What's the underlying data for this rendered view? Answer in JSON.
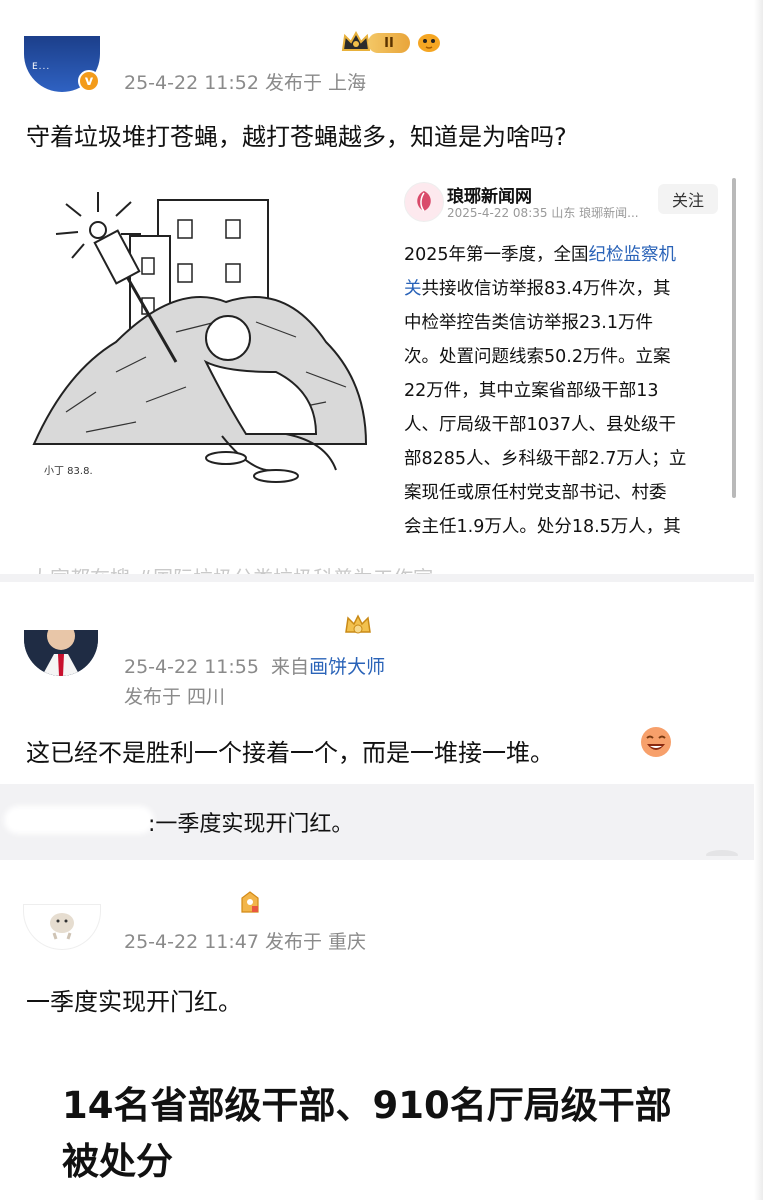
{
  "post1": {
    "avatar_label": "E...",
    "badge_label": "II",
    "meta": "25-4-22 11:52  发布于 上海",
    "text": "守着垃圾堆打苍蝇，越打苍蝇越多，知道是为啥吗?",
    "card": {
      "source_name": "琅琊新闻网",
      "source_meta": "2025-4-22 08:35 山东 琅琊新闻...",
      "follow_label": "关注",
      "comic_signature": "小丁 83.8.",
      "lines": [
        "2025年第一季度，全国",
        "纪检监察机",
        "关",
        "共接收信访举报83.4万件次，其",
        "中检举控告类信访举报23.1万件",
        "次。处置问题线索50.2万件。立案",
        "22万件，其中立案省部级干部13",
        "人、厅局级干部1037人、县处级干",
        "部8285人、乡科级干部2.7万人；立",
        "案现任或原任村党支部书记、村委",
        "会主任1.9万人。处分18.5万人，其"
      ]
    },
    "cut_off_text": "大家都在搜  #国际垃圾分类垃圾科普为工作室"
  },
  "post2": {
    "meta_time": "25-4-22 11:55",
    "meta_from": "来自",
    "meta_source": "画饼大师",
    "meta_location": "发布于 四川",
    "text": "这已经不是胜利一个接着一个，而是一堆接一堆。",
    "quote_text": ":一季度实现开门红。"
  },
  "post3": {
    "meta": "25-4-22 11:47  发布于 重庆",
    "text": "一季度实现开门红。",
    "headline_line1": "14名省部级干部、910名厅局级干部",
    "headline_line2": "被处分"
  },
  "colors": {
    "link": "#2a63b8",
    "meta": "#8a8a8a",
    "divider": "#f2f2f4"
  }
}
